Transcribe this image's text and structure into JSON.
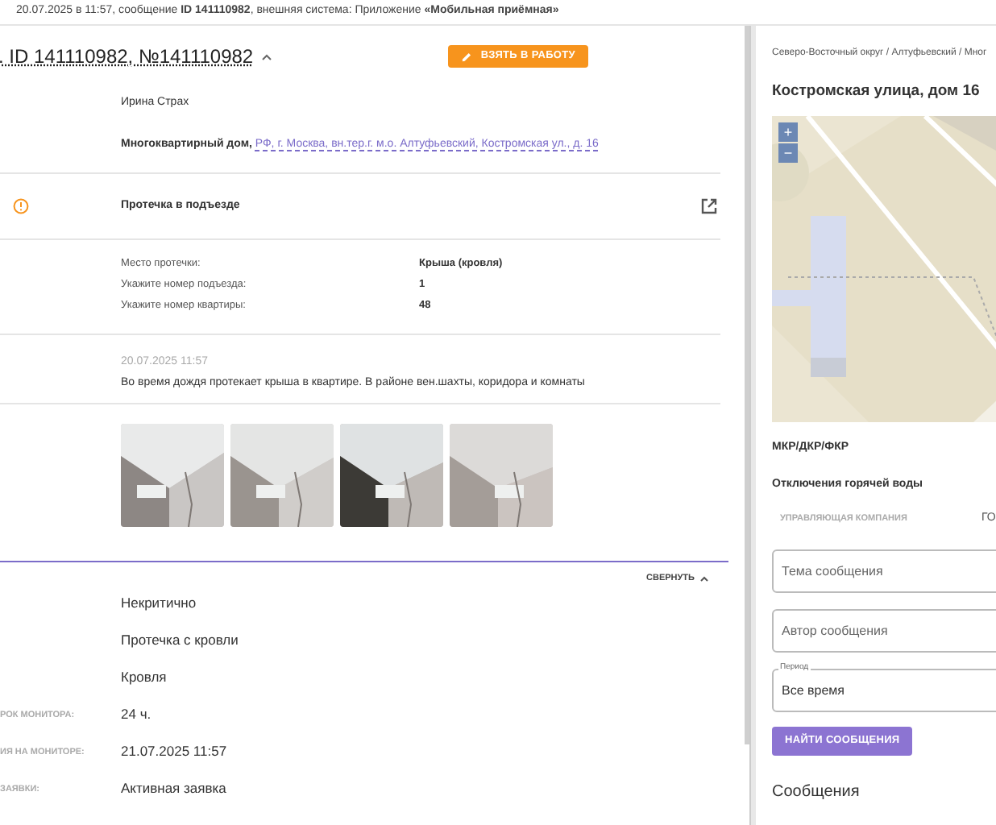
{
  "top_bar": {
    "text": "20.07.2025 в 11:57, сообщение **ID 141110982**, внешняя система: Приложение **«Мобильная приёмная»**"
  },
  "request": {
    "title": ". ID 141110982, №141110982",
    "take_button": "ВЗЯТЬ В РАБОТУ",
    "author": "Ирина Страх",
    "address_prefix": "Многоквартирный дом,",
    "address_link": "РФ, г. Москва, вн.тер.г. м.о. Алтуфьевский, Костромская ул., д. 16",
    "category": "Протечка в подъезде",
    "details": [
      {
        "label": "Место протечки:",
        "value": "Крыша (кровля)"
      },
      {
        "label": "Укажите номер подъезда:",
        "value": "1"
      },
      {
        "label": "Укажите номер квартиры:",
        "value": "48"
      }
    ],
    "message_date": "20.07.2025 11:57",
    "message_text": "Во время дождя протекает крыша в квартире. В районе вен.шахты, коридора и комнаты"
  },
  "info": {
    "collapse": "СВЕРНУТЬ",
    "rows": [
      {
        "value": "Некритично"
      },
      {
        "value": "Протечка с кровли"
      },
      {
        "value": "Кровля"
      },
      {
        "label": "РОК МОНИТОРА:",
        "value": "24 ч."
      },
      {
        "label": "ИЯ НА МОНИТОРЕ:",
        "value": "21.07.2025 11:57"
      },
      {
        "label": "ЗАЯВКИ:",
        "value": "Активная заявка"
      }
    ]
  },
  "side": {
    "breadcrumb": "Северо-Восточный округ / Алтуфьевский / Мног",
    "title": "Костромская улица, дом 16",
    "map": {
      "zoom_in": "+",
      "zoom_out": "−"
    },
    "program": "МКР/ДКР/ФКР",
    "outage": "Отключения горячей воды",
    "company_label": "УПРАВЛЯЮЩАЯ КОМПАНИЯ",
    "company_value": "ГО",
    "fields": [
      {
        "kind": "text",
        "placeholder": "Тема сообщения"
      },
      {
        "kind": "text",
        "placeholder": "Автор сообщения"
      },
      {
        "kind": "select",
        "label": "Период",
        "value": "Все время"
      }
    ],
    "search_button": "НАЙТИ СООБЩЕНИЯ",
    "messages_heading": "Сообщения"
  }
}
